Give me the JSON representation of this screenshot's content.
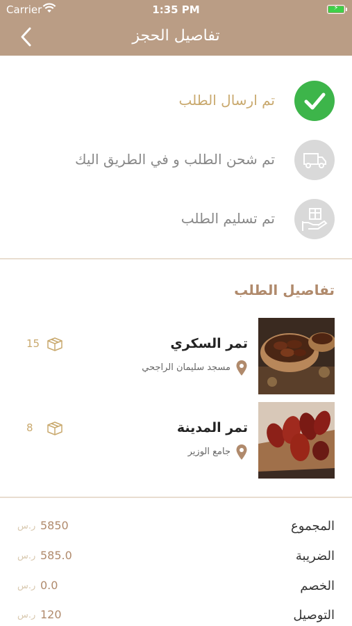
{
  "status_bar": {
    "carrier": "Carrier",
    "time": "1:35 PM"
  },
  "header": {
    "title": "تفاصيل الحجز"
  },
  "steps": [
    {
      "label": "تم ارسال الطلب",
      "done": true
    },
    {
      "label": "تم شحن الطلب و في الطريق اليك",
      "done": false
    },
    {
      "label": "تم تسليم الطلب",
      "done": false
    }
  ],
  "order": {
    "title": "تفاصيل الطلب",
    "items": [
      {
        "name": "تمر السكري",
        "place": "مسجد سليمان الراجحي",
        "qty": "15"
      },
      {
        "name": "تمر المدينة",
        "place": "جامع الوزير",
        "qty": "8"
      }
    ]
  },
  "summary": {
    "currency": "ر.س",
    "rows": [
      {
        "label": "المجموع",
        "value": "5850"
      },
      {
        "label": "الضريبة",
        "value": "585.0"
      },
      {
        "label": "الخصم",
        "value": "0.0"
      },
      {
        "label": "التوصيل",
        "value": "120"
      }
    ]
  },
  "colors": {
    "header": "#ba9d85",
    "accent": "#b08a6c",
    "done": "#3db54a",
    "pending": "#d9d9d9"
  }
}
